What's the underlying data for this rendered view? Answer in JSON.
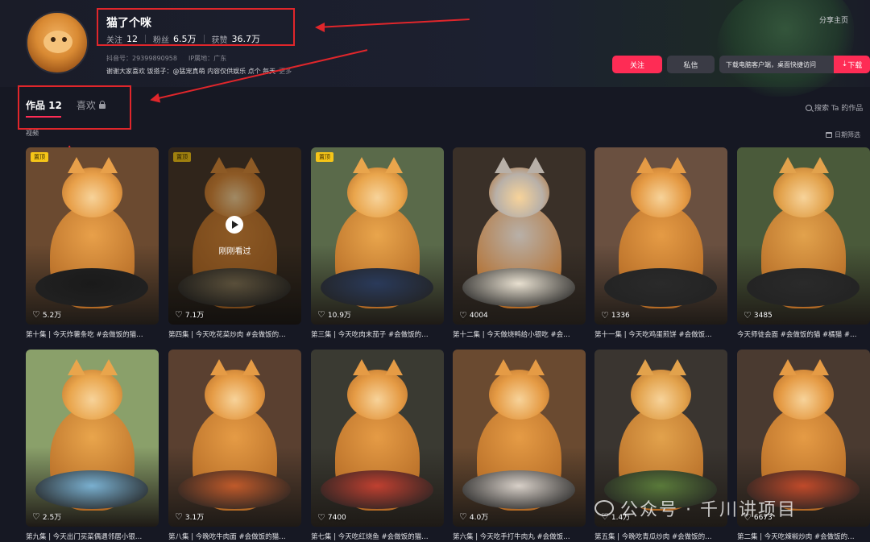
{
  "profile": {
    "nickname": "猫了个咪",
    "following_label": "关注",
    "following": "12",
    "followers_label": "粉丝",
    "followers": "6.5万",
    "likes_label": "获赞",
    "likes": "36.7万",
    "douyin_id": "抖音号：29399890958",
    "ip": "IP属地：广东",
    "bio": "谢谢大家喜欢 饭搭子：@猛宠真萌 内容仅供娱乐 点个    每天",
    "more": "更多"
  },
  "actions": {
    "share": "分享主页",
    "follow": "关注",
    "message": "私信",
    "download_tip": "下载电脑客户端，桌面快捷访问",
    "download": "下载"
  },
  "tabs": {
    "works": "作品 12",
    "likes": "喜欢"
  },
  "search": {
    "label": "搜索 Ta 的作品"
  },
  "section": {
    "label": "视频",
    "filter": "日期筛选"
  },
  "videos": [
    {
      "likes": "5.2万",
      "pinned": "置顶",
      "title": "第十集 | 今天炸薯条吃 #会做饭的猫…"
    },
    {
      "likes": "7.1万",
      "pinned": "置顶",
      "watched": "刚刚看过",
      "title": "第四集 | 今天吃花菜炒肉 #会做饭的…"
    },
    {
      "likes": "10.9万",
      "pinned": "置顶",
      "title": "第三集 | 今天吃肉末茄子 #会做饭的…"
    },
    {
      "likes": "4004",
      "title": "第十二集 | 今天做烧鸭给小银吃 #会…"
    },
    {
      "likes": "1336",
      "title": "第十一集 | 今天吃鸡蛋煎饼 #会做饭…"
    },
    {
      "likes": "3485",
      "title": "今天师徒会面 #会做饭的猫 #橘猫 #…"
    },
    {
      "likes": "2.5万",
      "title": "第九集 | 今天出门买菜偶遇邻居小银…"
    },
    {
      "likes": "3.1万",
      "title": "第八集 | 今晚吃牛肉面 #会做饭的猫…"
    },
    {
      "likes": "7400",
      "title": "第七集 | 今天吃红烧鱼 #会做饭的猫…"
    },
    {
      "likes": "4.0万",
      "title": "第六集 | 今天吃手打牛肉丸 #会做饭…"
    },
    {
      "likes": "1.4万",
      "title": "第五集 | 今晚吃青瓜炒肉 #会做饭的…"
    },
    {
      "likes": "6673",
      "title": "第二集 | 今天吃辣椒炒肉 #会做饭的…"
    }
  ],
  "watermark": "公众号 · 千川讲项目",
  "colors": {
    "accent": "#fe2c55",
    "annotation": "#e0262b",
    "pinned": "#f5c518",
    "background": "#161823"
  }
}
